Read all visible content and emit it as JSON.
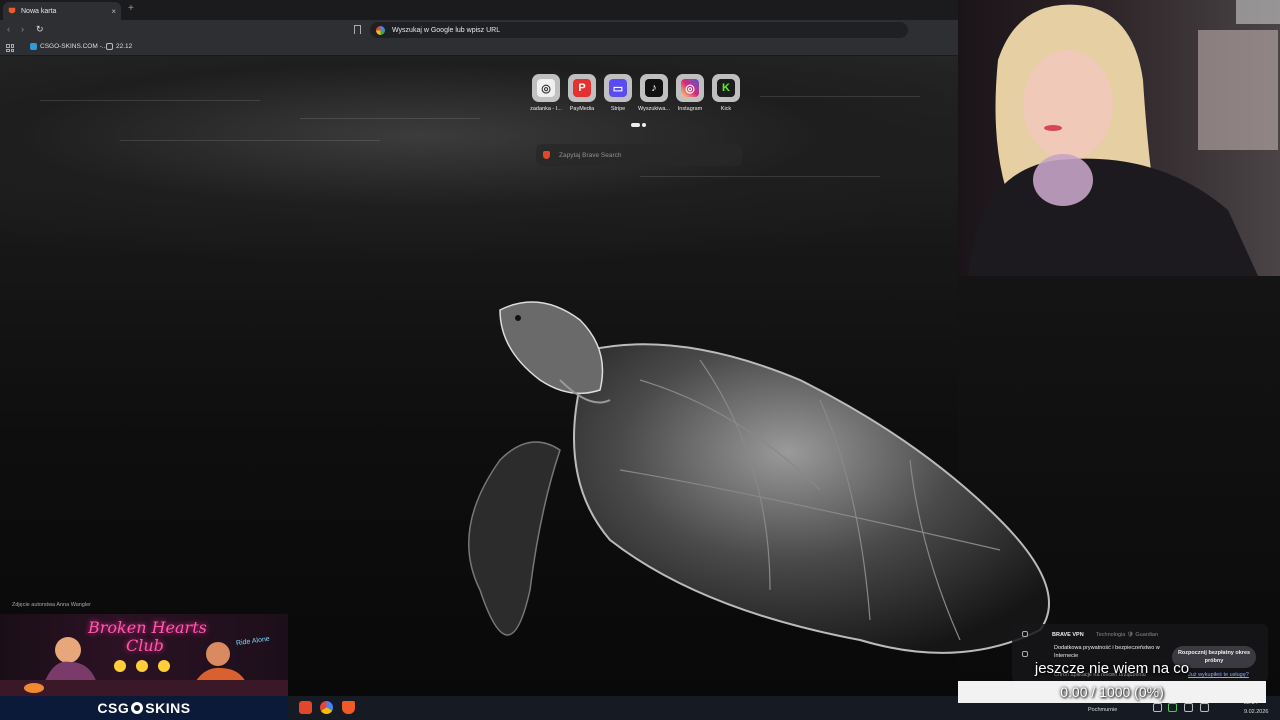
{
  "browser": {
    "tab_title": "Nowa karta",
    "new_tab_symbol": "+",
    "close_symbol": "×",
    "url_placeholder": "Wyszukaj w Google lub wpisz URL",
    "bookmarks": [
      "CSGO-SKINS.COM -...",
      "22.12"
    ]
  },
  "newtab": {
    "tiles": [
      {
        "label": "zadanka - I...",
        "icon": "zadanka-icon",
        "glyph": "◎",
        "color": "#f0f0f0"
      },
      {
        "label": "PayMedia",
        "icon": "paymedia-icon",
        "glyph": "P",
        "color": "#e5312f"
      },
      {
        "label": "Stripe",
        "icon": "stripe-icon",
        "glyph": "▭",
        "color": "#5a4cf0"
      },
      {
        "label": "Wyszukiwa...",
        "icon": "tiktok-icon",
        "glyph": "♪",
        "color": "#111111"
      },
      {
        "label": "Instagram",
        "icon": "instagram-icon",
        "glyph": "◎",
        "color": "#d6249f"
      },
      {
        "label": "Kick",
        "icon": "kick-icon",
        "glyph": "K",
        "color": "#1c1c1c"
      }
    ],
    "search_placeholder": "Zapytaj Brave Search",
    "photo_credit": "Zdjęcie autorstwa Anna Wangler"
  },
  "promo": {
    "title_line1": "Broken Hearts",
    "title_line2": "Club",
    "side_sign": "Ride Alone",
    "brand_left": "CSG",
    "brand_right": "SKINS"
  },
  "vpn_popup": {
    "title": "BRAVE VPN",
    "tech": "Technologia 🛡 Guardian",
    "description": "Dodatkowa prywatność i bezpieczeństwo w Internecie",
    "line2": "Chroń aplikacje na niecen urządzeniu",
    "button": "Rozpocznij bezpłatny okres próbny",
    "link": "Już wykupiłeś te usługę?"
  },
  "goal": {
    "text": "jeszcze nie wiem na co",
    "value": "0.00 / 1000 (0%)",
    "progress": 0.0,
    "fill_color": "#3aa55a"
  },
  "taskbar": {
    "weather": "Pochmurnie",
    "time": "22:34",
    "date": "9.02.2026"
  }
}
